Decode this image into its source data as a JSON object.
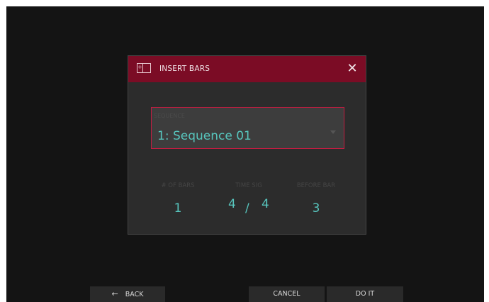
{
  "dialog": {
    "title": "INSERT BARS",
    "close_icon": "close-icon",
    "header_icon": "insert-bars-icon",
    "colors": {
      "header": "#7b0c25",
      "accent": "#57c5bd",
      "focus_border": "#c11d41"
    }
  },
  "sequence": {
    "label": "SEQUENCE",
    "value": "1: Sequence 01"
  },
  "fields": {
    "bars": {
      "label": "# OF BARS",
      "value": "1"
    },
    "time_sig": {
      "label": "TIME SIG",
      "numerator": "4",
      "separator": "/",
      "denominator": "4"
    },
    "before_bar": {
      "label": "BEFORE BAR",
      "value": "3"
    }
  },
  "bottom": {
    "back_icon": "←",
    "back_label": "BACK",
    "cancel_label": "CANCEL",
    "doit_label": "DO IT"
  }
}
